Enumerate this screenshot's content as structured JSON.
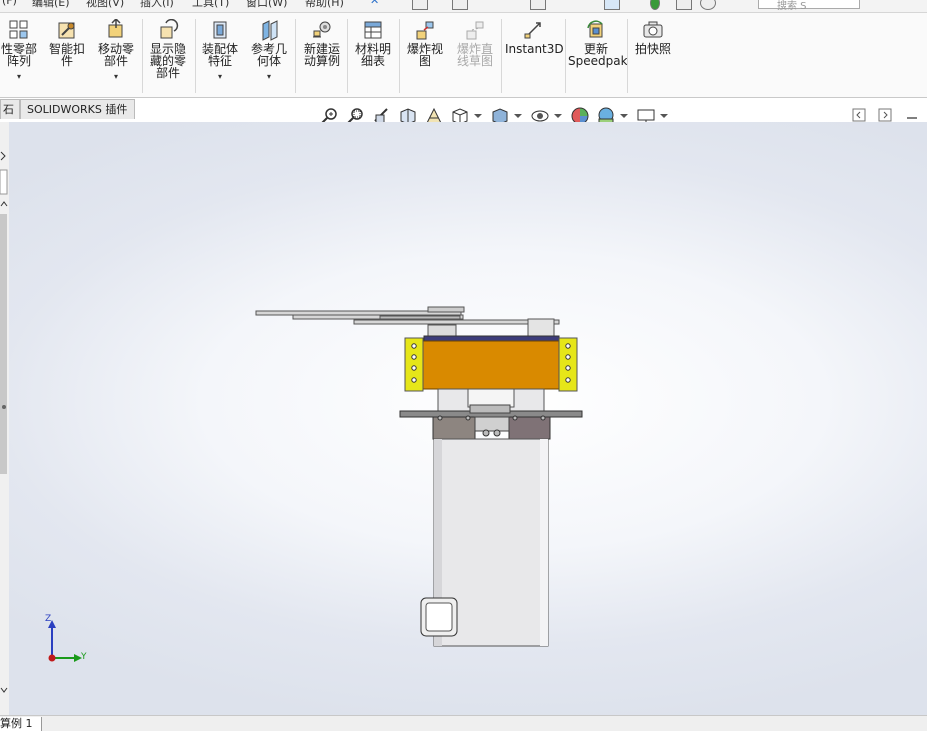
{
  "menu": {
    "items": [
      "编辑(E)",
      "视图(V)",
      "插入(I)",
      "工具(T)",
      "窗口(W)",
      "帮助(H)"
    ],
    "search_placeholder": "搜索 S"
  },
  "ribbon": {
    "items": [
      {
        "label_line1": "性零部",
        "label_line2": "阵列",
        "icon": "linear-pattern-icon"
      },
      {
        "label_line1": "智能扣",
        "label_line2": "件",
        "icon": "smart-fasteners-icon"
      },
      {
        "label_line1": "移动零",
        "label_line2": "部件",
        "icon": "move-component-icon"
      },
      {
        "label_line1": "显示隐",
        "label_line2": "藏的零",
        "label_line3": "部件",
        "icon": "show-hidden-components-icon"
      },
      {
        "label_line1": "装配体",
        "label_line2": "特征",
        "icon": "assembly-features-icon"
      },
      {
        "label_line1": "参考几",
        "label_line2": "何体",
        "icon": "reference-geometry-icon"
      },
      {
        "label_line1": "新建运",
        "label_line2": "动算例",
        "icon": "new-motion-study-icon"
      },
      {
        "label_line1": "材料明",
        "label_line2": "细表",
        "icon": "bill-of-materials-icon"
      },
      {
        "label_line1": "爆炸视",
        "label_line2": "图",
        "icon": "exploded-view-icon"
      },
      {
        "label_line1": "爆炸直",
        "label_line2": "线草图",
        "icon": "explode-line-sketch-icon"
      },
      {
        "label_line1": "Instant3D",
        "icon": "instant3d-icon"
      },
      {
        "label_line1": "更新",
        "label_line2": "Speedpak",
        "icon": "update-speedpak-icon"
      },
      {
        "label_line1": "拍快照",
        "icon": "take-snapshot-icon"
      }
    ]
  },
  "tabs": {
    "partial": "石",
    "solidworks_addins": "SOLIDWORKS 插件"
  },
  "status": {
    "tab_label": "算例 1"
  },
  "triad": {
    "z_label": "Z",
    "y_label": "Y"
  },
  "colors": {
    "orange_body": "#d98a00",
    "yellow_bracket": "#e6e619",
    "cylinder": "#e8e8ea",
    "plate": "#8a8a8a"
  }
}
